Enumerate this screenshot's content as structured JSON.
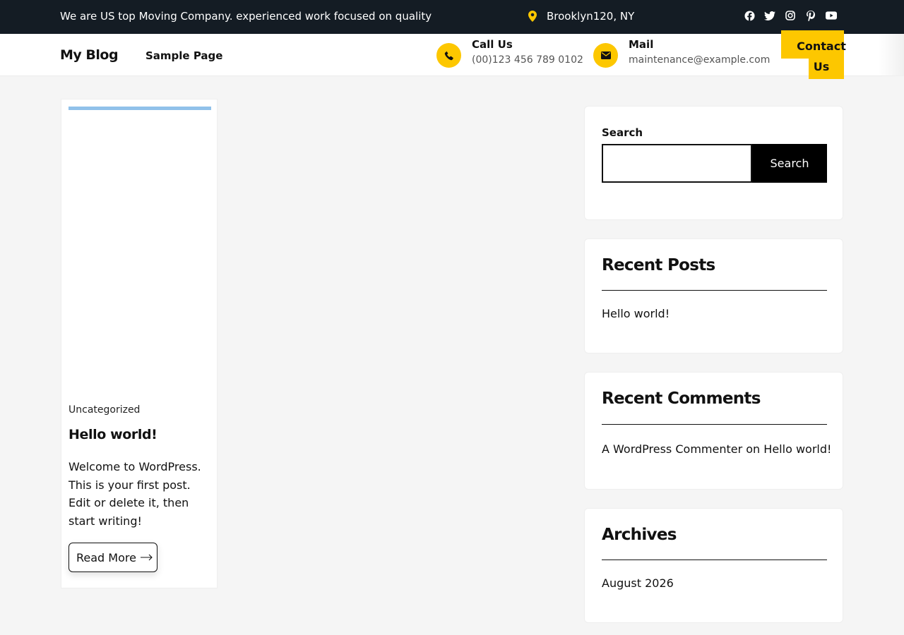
{
  "topbar": {
    "tagline": "We are US top Moving Company. experienced work focused on quality",
    "location": "Brooklyn120, NY",
    "social": [
      "facebook-icon",
      "twitter-icon",
      "instagram-icon",
      "pinterest-icon",
      "youtube-icon"
    ]
  },
  "header": {
    "logo": "My Blog",
    "nav": [
      "Sample Page"
    ],
    "call": {
      "title": "Call Us",
      "value": "(00)123 456 789 0102"
    },
    "mail": {
      "title": "Mail",
      "value": "maintenance@example.com"
    },
    "contact_button": "Contact Us"
  },
  "post": {
    "category": "Uncategorized",
    "title": "Hello world!",
    "excerpt": "Welcome to WordPress. This is your first post. Edit or delete it, then start writing!",
    "read_more": "Read More"
  },
  "sidebar": {
    "search": {
      "label": "Search",
      "button": "Search",
      "value": ""
    },
    "recent_posts": {
      "title": "Recent Posts",
      "items": [
        "Hello world!"
      ]
    },
    "recent_comments": {
      "title": "Recent Comments",
      "author": "A WordPress Commenter",
      "joiner": "on",
      "post": "Hello world!"
    },
    "archives": {
      "title": "Archives",
      "items": [
        "August 2026"
      ]
    }
  },
  "colors": {
    "accent": "#fdc700",
    "topbar": "#141c24",
    "progress": "#90c1ea"
  }
}
